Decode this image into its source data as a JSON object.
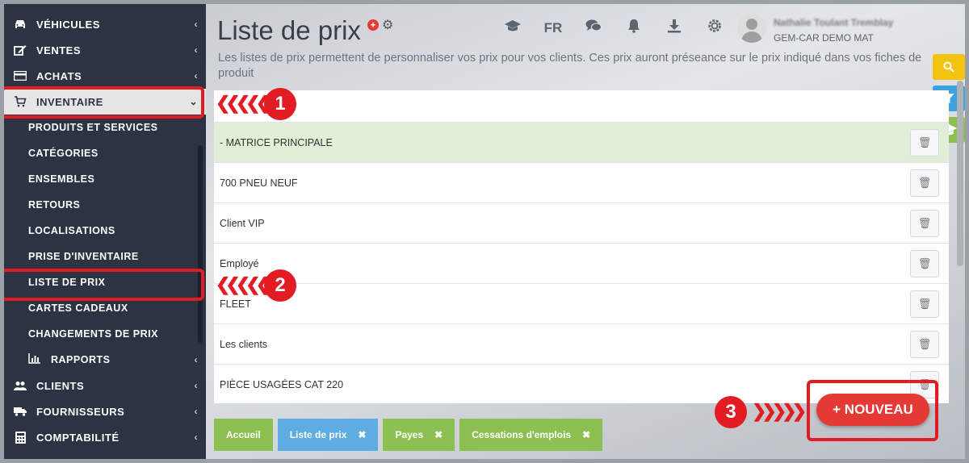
{
  "sidebar": {
    "items": [
      {
        "label": "VÉHICULES",
        "icon": "car-icon",
        "chevron": "‹"
      },
      {
        "label": "VENTES",
        "icon": "edit-icon",
        "chevron": "‹"
      },
      {
        "label": "ACHATS",
        "icon": "credit-card-icon",
        "chevron": "‹"
      },
      {
        "label": "INVENTAIRE",
        "icon": "cart-icon",
        "chevron": "⌄"
      }
    ],
    "subitems": [
      "PRODUITS ET SERVICES",
      "CATÉGORIES",
      "ENSEMBLES",
      "RETOURS",
      "LOCALISATIONS",
      "PRISE D'INVENTAIRE",
      "LISTE DE PRIX",
      "CARTES CADEAUX",
      "CHANGEMENTS DE PRIX"
    ],
    "rapports": {
      "label": "RAPPORTS",
      "icon": "bar-chart-icon",
      "chevron": "‹"
    },
    "bottom_items": [
      {
        "label": "CLIENTS",
        "icon": "users-icon",
        "chevron": "‹"
      },
      {
        "label": "FOURNISSEURS",
        "icon": "truck-icon",
        "chevron": "‹"
      },
      {
        "label": "COMPTABILITÉ",
        "icon": "calculator-icon",
        "chevron": "‹"
      }
    ]
  },
  "header": {
    "title": "Liste de prix",
    "subtitle": "Les listes de prix permettent de personnaliser vos prix pour vos clients. Ces prix auront préseance sur le prix indiqué dans vos fiches de produit",
    "lang": "FR",
    "user_name": "Nathalie Toulant Tremblay",
    "user_company": "GEM-CAR DEMO MAT"
  },
  "price_lists": [
    "- MATRICE PRINCIPALE",
    "700 PNEU NEUF",
    "Client VIP",
    "Employé",
    "FLEET",
    "Les clients",
    "PIÈCE USAGÉES CAT 220"
  ],
  "bottom_tabs": [
    {
      "label": "Accueil",
      "closable": false
    },
    {
      "label": "Liste de prix",
      "closable": true
    },
    {
      "label": "Payes",
      "closable": true
    },
    {
      "label": "Cessations d'emplois",
      "closable": true
    }
  ],
  "new_button": "+ NOUVEAU",
  "annotations": [
    "1",
    "2",
    "3"
  ],
  "colors": {
    "sidebar_bg": "#2c3444",
    "accent_red": "#e53935",
    "tab_green": "#8cc152",
    "tab_blue": "#5dade2",
    "highlight_row": "#e1efd9"
  }
}
